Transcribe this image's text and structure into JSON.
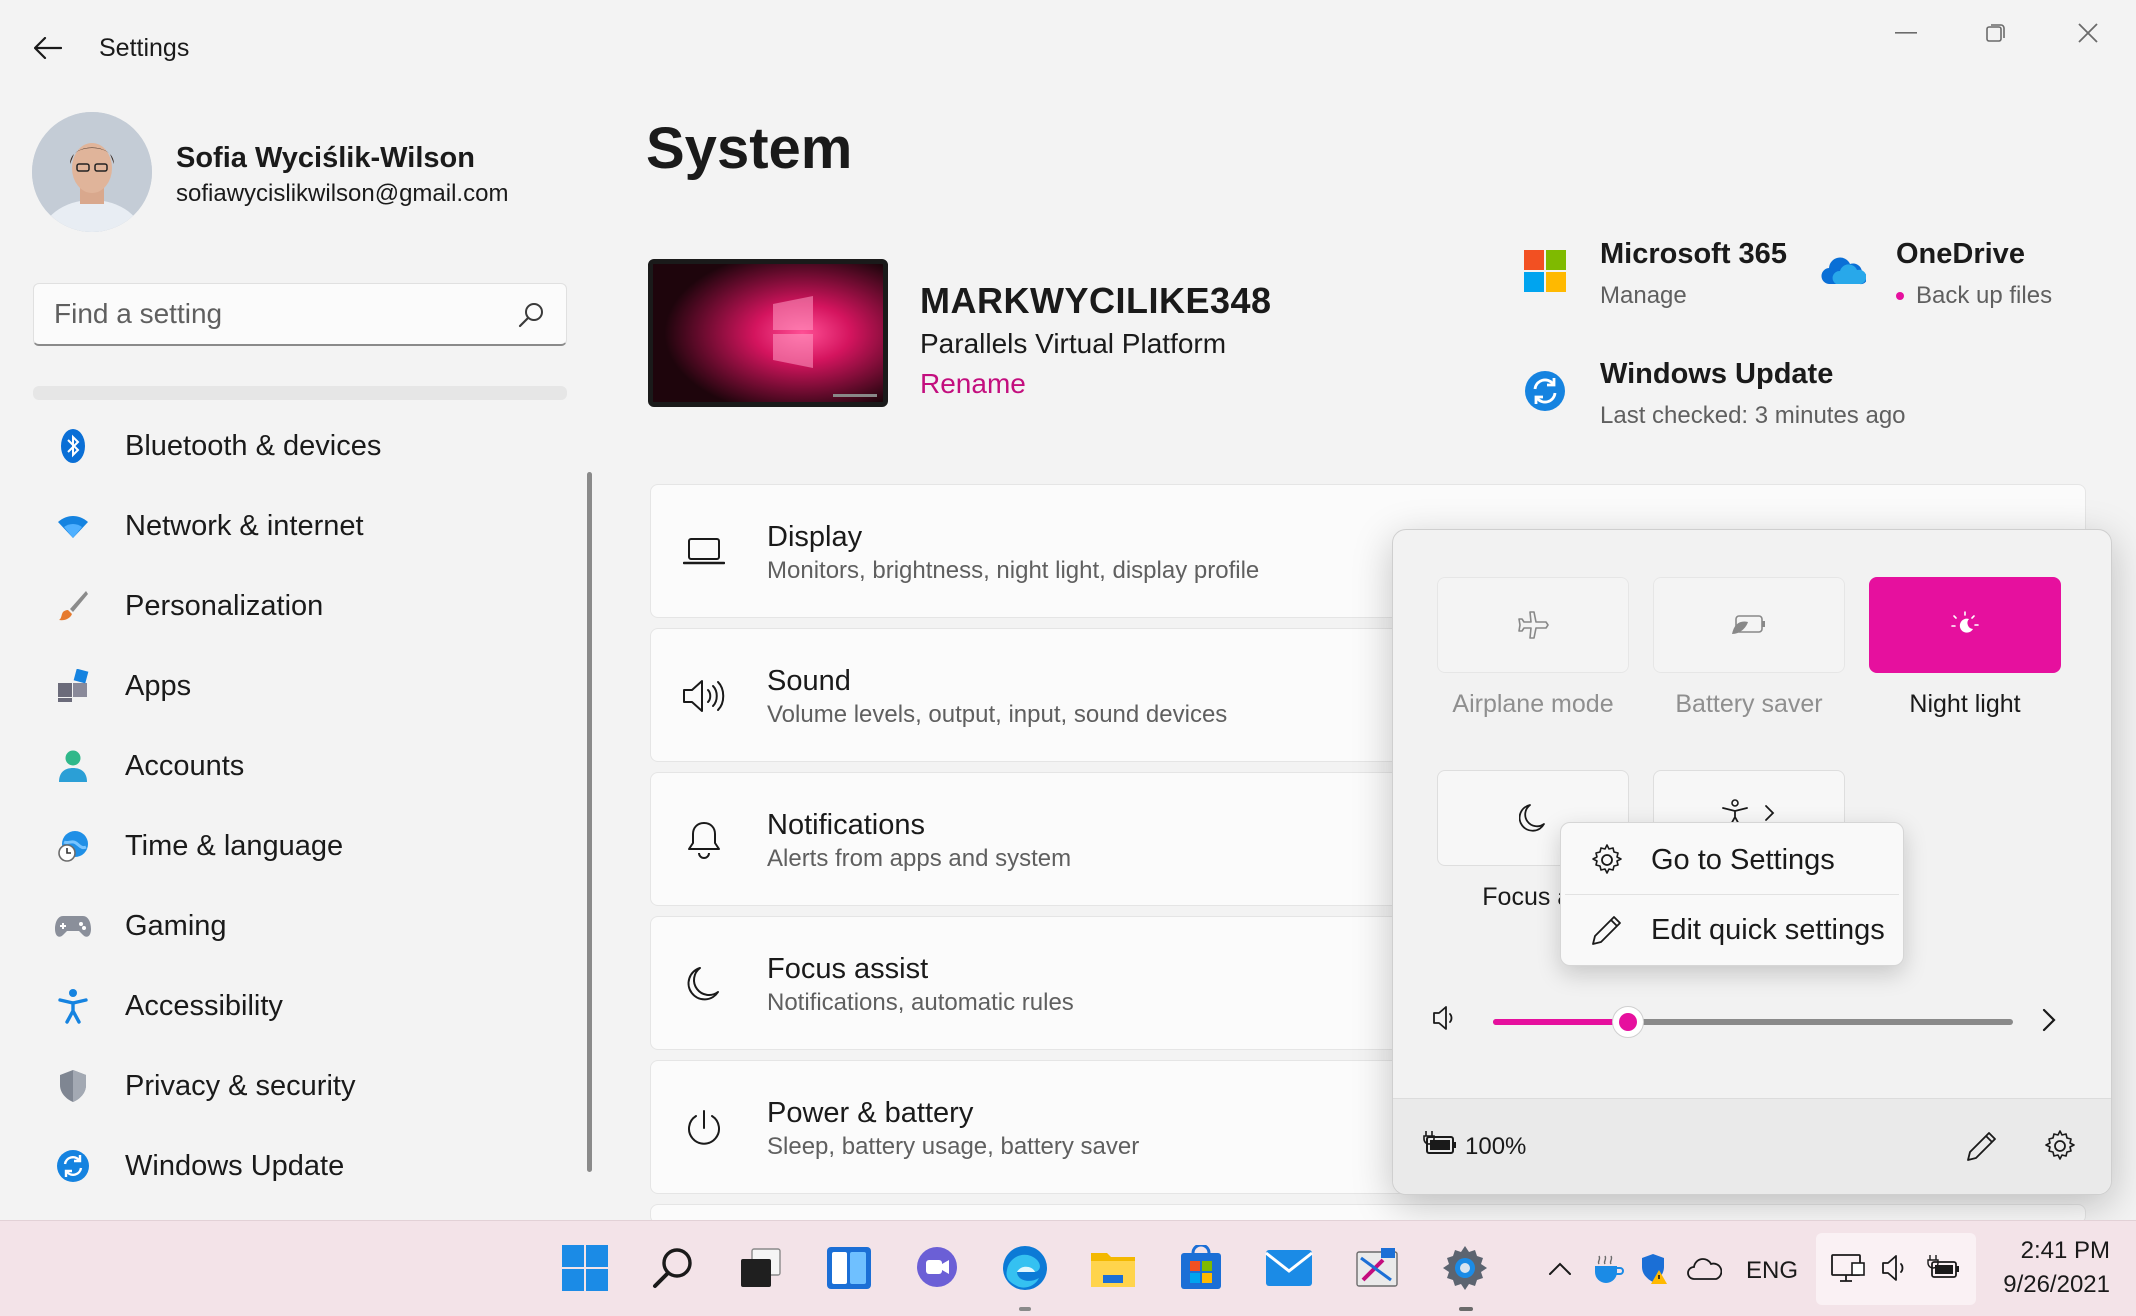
{
  "window": {
    "title": "Settings"
  },
  "profile": {
    "name": "Sofia Wyciślik-Wilson",
    "email": "sofiawycislikwilson@gmail.com"
  },
  "search": {
    "placeholder": "Find a setting"
  },
  "sidebar": {
    "items": [
      {
        "label": "Bluetooth & devices",
        "icon": "bluetooth-icon"
      },
      {
        "label": "Network & internet",
        "icon": "wifi-icon"
      },
      {
        "label": "Personalization",
        "icon": "brush-icon"
      },
      {
        "label": "Apps",
        "icon": "apps-icon"
      },
      {
        "label": "Accounts",
        "icon": "person-icon"
      },
      {
        "label": "Time & language",
        "icon": "globe-clock-icon"
      },
      {
        "label": "Gaming",
        "icon": "gamepad-icon"
      },
      {
        "label": "Accessibility",
        "icon": "accessibility-icon"
      },
      {
        "label": "Privacy & security",
        "icon": "shield-icon"
      },
      {
        "label": "Windows Update",
        "icon": "update-icon"
      }
    ]
  },
  "main": {
    "page_title": "System",
    "device": {
      "name": "MARKWYCILIKE348",
      "model": "Parallels Virtual Platform",
      "rename": "Rename"
    },
    "quick_links": [
      {
        "title": "Microsoft 365",
        "subtitle": "Manage",
        "icon": "microsoft-logo-icon"
      },
      {
        "title": "OneDrive",
        "subtitle": "Back up files",
        "icon": "onedrive-cloud-icon"
      },
      {
        "title": "Windows Update",
        "subtitle": "Last checked: 3 minutes ago",
        "icon": "windows-update-icon"
      }
    ],
    "cards": [
      {
        "title": "Display",
        "subtitle": "Monitors, brightness, night light, display profile",
        "icon": "laptop-icon"
      },
      {
        "title": "Sound",
        "subtitle": "Volume levels, output, input, sound devices",
        "icon": "speaker-icon"
      },
      {
        "title": "Notifications",
        "subtitle": "Alerts from apps and system",
        "icon": "bell-icon"
      },
      {
        "title": "Focus assist",
        "subtitle": "Notifications, automatic rules",
        "icon": "moon-icon"
      },
      {
        "title": "Power & battery",
        "subtitle": "Sleep, battery usage, battery saver",
        "icon": "power-icon"
      }
    ]
  },
  "quick_settings": {
    "tiles": [
      {
        "label": "Airplane mode",
        "state": "disabled",
        "icon": "airplane-icon"
      },
      {
        "label": "Battery saver",
        "state": "disabled",
        "icon": "battery-saver-icon"
      },
      {
        "label": "Night light",
        "state": "on",
        "icon": "night-light-icon"
      },
      {
        "label": "Focus as",
        "state": "off",
        "icon": "moon-icon"
      },
      {
        "label": "",
        "state": "off",
        "icon": "accessibility-icon"
      }
    ],
    "volume_fraction": 0.26,
    "battery_text": "100%",
    "accent": "#e6109e"
  },
  "context_menu": {
    "items": [
      {
        "label": "Go to Settings",
        "icon": "gear-icon"
      },
      {
        "label": "Edit quick settings",
        "icon": "pencil-icon"
      }
    ]
  },
  "taskbar": {
    "language": "ENG",
    "time": "2:41 PM",
    "date": "9/26/2021"
  }
}
